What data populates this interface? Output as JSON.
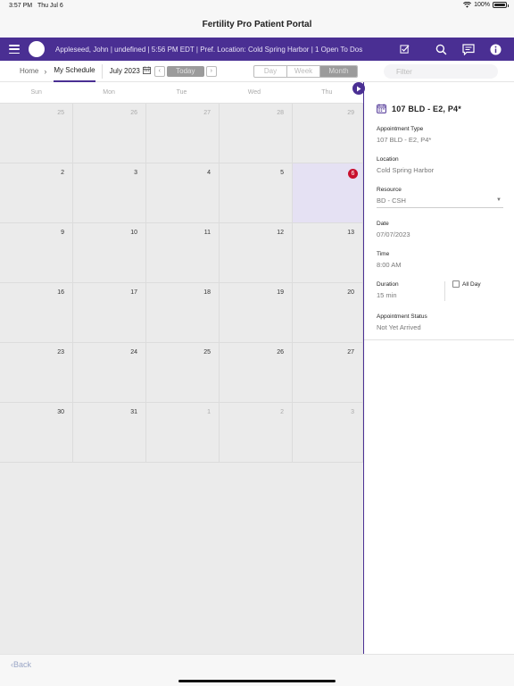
{
  "status_bar": {
    "time": "3:57 PM",
    "date": "Thu Jul 6",
    "battery": "100%"
  },
  "app_title": "Fertility Pro Patient Portal",
  "top_bar": {
    "patient_info": "Appleseed, John | undefined | 5:56 PM EDT | Pref. Location: Cold Spring Harbor | 1 Open To Dos",
    "icons": [
      "menu-icon",
      "avatar",
      "checklist-icon",
      "search-icon",
      "messages-icon",
      "info-icon"
    ]
  },
  "toolbar": {
    "breadcrumb_home": "Home",
    "breadcrumb_current": "My Schedule",
    "month_label": "July 2023",
    "today_label": "Today",
    "view_options": [
      "Day",
      "Week",
      "Month"
    ],
    "selected_view": "Month",
    "filter_placeholder": "Filter"
  },
  "calendar": {
    "weekdays": [
      "Sun",
      "Mon",
      "Tue",
      "Wed",
      "Thu"
    ],
    "weeks": [
      [
        {
          "d": "25",
          "other": true
        },
        {
          "d": "26",
          "other": true
        },
        {
          "d": "27",
          "other": true
        },
        {
          "d": "28",
          "other": true
        },
        {
          "d": "29",
          "other": true
        }
      ],
      [
        {
          "d": "2"
        },
        {
          "d": "3"
        },
        {
          "d": "4"
        },
        {
          "d": "5"
        },
        {
          "d": "6",
          "today": true
        }
      ],
      [
        {
          "d": "9"
        },
        {
          "d": "10"
        },
        {
          "d": "11"
        },
        {
          "d": "12"
        },
        {
          "d": "13"
        }
      ],
      [
        {
          "d": "16"
        },
        {
          "d": "17"
        },
        {
          "d": "18"
        },
        {
          "d": "19"
        },
        {
          "d": "20"
        }
      ],
      [
        {
          "d": "23"
        },
        {
          "d": "24"
        },
        {
          "d": "25"
        },
        {
          "d": "26"
        },
        {
          "d": "27"
        }
      ],
      [
        {
          "d": "30"
        },
        {
          "d": "31"
        },
        {
          "d": "1",
          "other": true
        },
        {
          "d": "2",
          "other": true
        },
        {
          "d": "3",
          "other": true
        }
      ]
    ]
  },
  "detail": {
    "title": "107 BLD - E2, P4*",
    "appointment_type_label": "Appointment Type",
    "appointment_type": "107 BLD - E2, P4*",
    "location_label": "Location",
    "location": "Cold Spring Harbor",
    "resource_label": "Resource",
    "resource": "BD - CSH",
    "date_label": "Date",
    "date": "07/07/2023",
    "time_label": "Time",
    "time": "8:00 AM",
    "duration_label": "Duration",
    "duration": "15 min",
    "all_day_label": "All Day",
    "all_day": false,
    "status_label": "Appointment Status",
    "status": "Not Yet Arrived"
  },
  "footer": {
    "back_label": "Back"
  },
  "colors": {
    "brand": "#4a2f93",
    "today_badge": "#c8102e",
    "today_cell": "#e5e1f3",
    "cell_bg": "#ebebeb"
  }
}
